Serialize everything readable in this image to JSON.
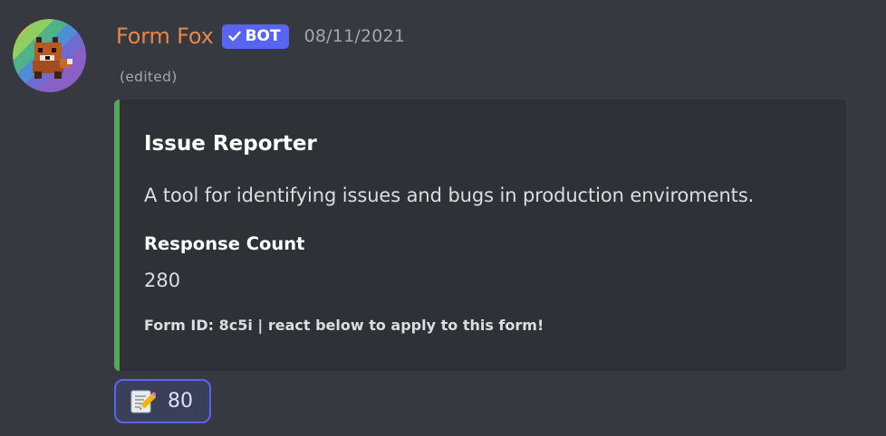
{
  "message": {
    "author": {
      "username": "Form Fox",
      "avatar_icon": "fox-avatar-icon",
      "name_color": "#e8864a"
    },
    "bot_tag": {
      "label": "BOT",
      "icon": "checkmark-icon",
      "color": "#5865f2"
    },
    "timestamp": "08/11/2021",
    "edited_label": "(edited)"
  },
  "embed": {
    "accent_color": "#57a65a",
    "title": "Issue Reporter",
    "description": "A tool for identifying issues and bugs in production enviroments.",
    "field": {
      "name": "Response Count",
      "value": "280"
    },
    "footer": "Form ID: 8c5i | react below to apply to this form!"
  },
  "reaction": {
    "emoji": "memo-icon",
    "count": "80",
    "border_color": "#5865f2"
  },
  "colors": {
    "background": "#36393f",
    "embed_background": "#2f3136"
  }
}
